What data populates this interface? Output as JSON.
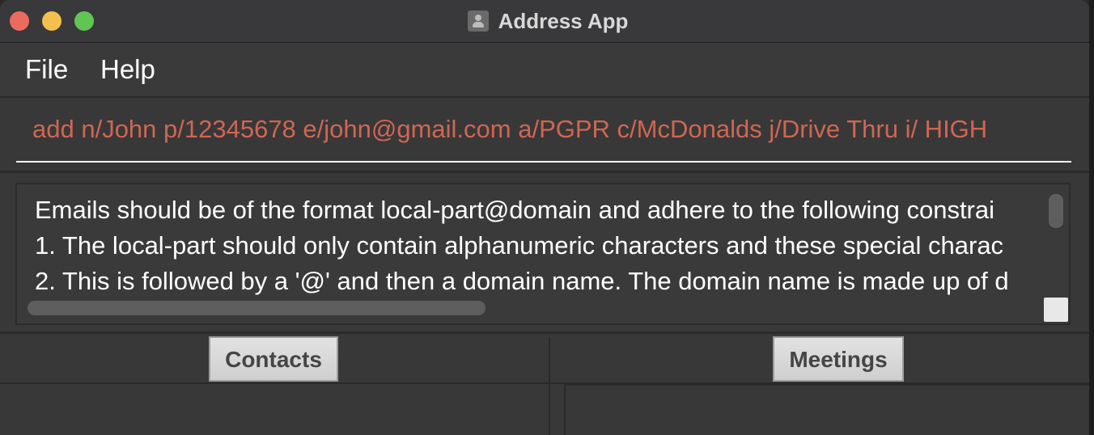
{
  "window": {
    "title": "Address App",
    "icon": "address-book-icon"
  },
  "menu": {
    "file_label": "File",
    "help_label": "Help"
  },
  "command": {
    "value": "add n/John p/12345678 e/john@gmail.com a/PGPR c/McDonalds j/Drive Thru i/ HIGH"
  },
  "result": {
    "lines": [
      "Emails should be of the format local-part@domain and adhere to the following constrai",
      "1. The local-part should only contain alphanumeric characters and these special charac",
      "2. This is followed by a '@' and then a domain name. The domain name is made up of d"
    ]
  },
  "tabs": {
    "contacts_label": "Contacts",
    "meetings_label": "Meetings"
  },
  "colors": {
    "command_text": "#d06652",
    "background": "#3b3b3b"
  }
}
